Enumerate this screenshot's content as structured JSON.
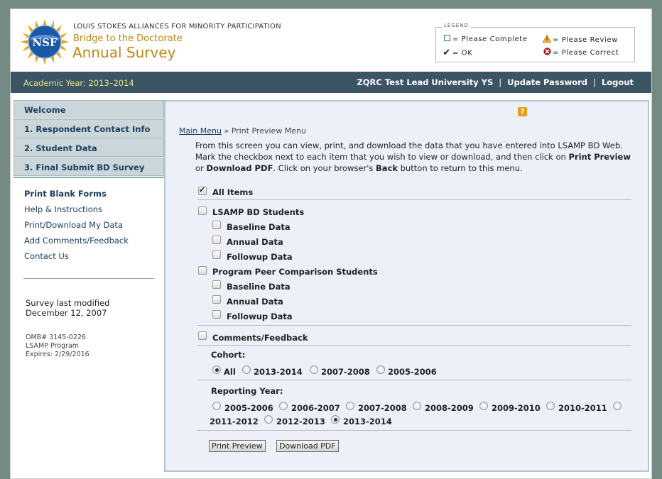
{
  "header": {
    "org": "LOUIS STOKES ALLIANCES FOR MINORITY PARTICIPATION",
    "subtitle": "Bridge to the Doctorate",
    "title": "Annual Survey",
    "logo_text": "NSF"
  },
  "legend": {
    "title": "LEGEND",
    "complete": "= Please Complete",
    "review": "= Please Review",
    "ok": "= OK",
    "correct": "= Please Correct"
  },
  "topbar": {
    "academic_year": "Academic Year: 2013–2014",
    "user": "ZQRC Test Lead University YS",
    "update_password": "Update Password",
    "logout": "Logout"
  },
  "nav": [
    {
      "label": "Welcome"
    },
    {
      "label": "1. Respondent Contact Info"
    },
    {
      "label": "2. Student Data"
    },
    {
      "label": "3. Final Submit BD Survey"
    }
  ],
  "sidelinks": {
    "print_blank": "Print Blank Forms",
    "help": "Help & Instructions",
    "print_download": "Print/Download My Data",
    "comments": "Add Comments/Feedback",
    "contact": "Contact Us"
  },
  "modified": {
    "line1": "Survey last modified",
    "line2": "December 12, 2007"
  },
  "omb": {
    "line1": "OMB# 3145-0226",
    "line2": "LSAMP Program",
    "line3": "Expires: 2/29/2016"
  },
  "main": {
    "crumb_link": "Main Menu",
    "crumb_current": "» Print Preview Menu",
    "intro_1": "From this screen you can view, print, and download the data that you have entered into LSAMP BD Web. Mark the checkbox next to each item that you wish to view or download, and then click on ",
    "intro_b1": "Print Preview",
    "intro_2": " or ",
    "intro_b2": "Download PDF",
    "intro_3": ". Click on your browser's ",
    "intro_b3": "Back",
    "intro_4": " button to return to this menu.",
    "all_items": "All Items",
    "lsamp": "LSAMP BD Students",
    "baseline": "Baseline Data",
    "annual": "Annual Data",
    "followup": "Followup Data",
    "peer": "Program Peer Comparison Students",
    "comments": "Comments/Feedback",
    "cohort_label": "Cohort:",
    "cohorts": [
      "All",
      "2013-2014",
      "2007-2008",
      "2005-2006"
    ],
    "cohort_selected": "All",
    "reporting_label": "Reporting Year:",
    "years": [
      "2005-2006",
      "2006-2007",
      "2007-2008",
      "2008-2009",
      "2009-2010",
      "2010-2011",
      "2011-2012",
      "2012-2013",
      "2013-2014"
    ],
    "year_selected": "2013-2014",
    "print_preview": "Print Preview",
    "download_pdf": "Download PDF"
  },
  "checked": {
    "all_items": true
  },
  "colors": {
    "topbar": "#3c5564",
    "accent": "#c38714",
    "nav_bg": "#cbd6da",
    "main_bg": "#edf0f9"
  }
}
